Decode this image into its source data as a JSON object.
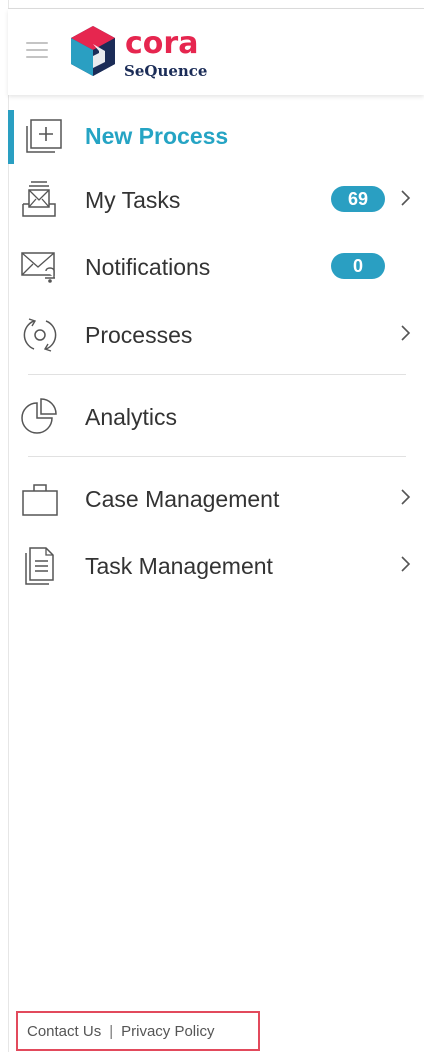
{
  "brand": {
    "name": "cora",
    "product": "SeQuence"
  },
  "menu": {
    "items": [
      {
        "label": "New Process",
        "icon": "new-process-icon",
        "active": true
      },
      {
        "label": "My Tasks",
        "icon": "tasks-inbox-icon",
        "badge": "69",
        "chevron": true
      },
      {
        "label": "Notifications",
        "icon": "notification-envelope-icon",
        "badge": "0"
      },
      {
        "label": "Processes",
        "icon": "processes-cycle-icon",
        "chevron": true
      },
      {
        "label": "Analytics",
        "icon": "pie-chart-icon"
      },
      {
        "label": "Case Management",
        "icon": "briefcase-icon",
        "chevron": true
      },
      {
        "label": "Task Management",
        "icon": "document-list-icon",
        "chevron": true
      }
    ]
  },
  "footer": {
    "contact": "Contact Us",
    "separator": "|",
    "privacy": "Privacy Policy"
  },
  "colors": {
    "accent": "#2a9fc2",
    "active_text": "#25a4c4",
    "brand_red": "#e6264f",
    "brand_navy": "#1b2c57",
    "highlight_box": "#e24a5c"
  }
}
